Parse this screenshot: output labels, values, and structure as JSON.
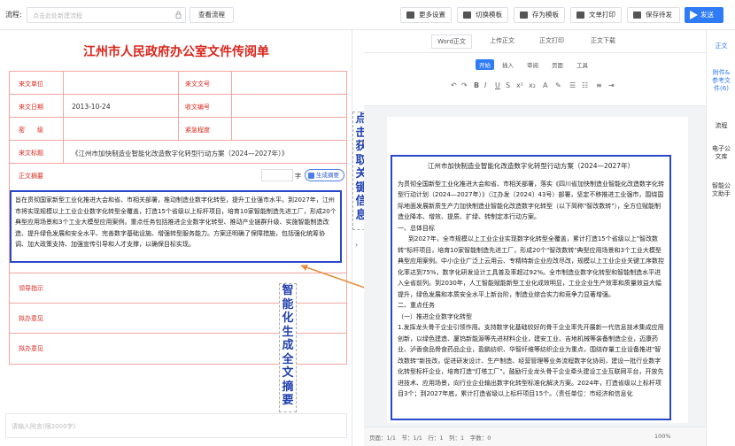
{
  "toolbar": {
    "flow_label": "流程:",
    "flow_placeholder": "点击此处新建流程",
    "view_flow": "查看流程",
    "more_settings": "更多设置",
    "switch_template": "切换模板",
    "save_template": "存为模板",
    "print": "文单打印",
    "save_send": "保存待发",
    "send": "发送"
  },
  "form": {
    "title": "江州市人民政府办公室文件传阅单",
    "unit_label": "来文单位",
    "docno_label": "来文文号",
    "date_label": "来文日期",
    "date_value": "2013-10-24",
    "recv_label": "收文编号",
    "secret_label": "密　　级",
    "urgent_label": "紧急程度",
    "subject_label": "来文标题",
    "subject_value": "《江州市加快制造业智能化改造数字化转型行动方案（2024—2027年）》",
    "summary_label": "正文摘要",
    "word_unit": "字",
    "gen_summary": "生成摘要",
    "summary_text": "旨在贯彻国家新型工业化推进大会和省、市相关部署，推动制造业数字化转型，提升工业强市水平。到2027年，江州市将实现规模以上工业企业数字化转型全覆盖，打造15个省级以上标杆项目，培育10家智能制造先进工厂，形成20个典型应用场景和3个工业大模型应用案例。重点任务包括推进企业数字化转型、推动产业链群升级、实施智能制造改造、提升绿色发展和安全水平、完善数字基础设施、增强转型服务能力。方案还明确了保障措施，包括强化统筹协调、加大政策支持、加强宣传引导和人才支撑，以确保目标实现。",
    "leader_label": "领导指示",
    "opinion1_label": "拟办意见",
    "opinion2_label": "拟办意见",
    "comment_placeholder": "请输入附言(限2000字)"
  },
  "annotations": {
    "click_key": "点击获取关键信息",
    "smart_summary": "智能化生成全文摘要"
  },
  "doc": {
    "word_format": "Word正文",
    "upload": "上传正文",
    "print": "正文打印",
    "download": "正文下载",
    "tabs": [
      "开始",
      "插入",
      "审阅",
      "页面",
      "工具"
    ],
    "title": "江州市加快制造业智能化改造数字化转型行动方案（2024—2027年）",
    "paragraphs": [
      "为贯彻全国新型工业化推进大会和省、市相关部署，落实《四川省加快制造业智能化改造数字化转型行动计划（2024—2027年）》（江办发〔2024〕43号）部署，坚定不移推进工业强市，围绕国际地面发展新质生产力加快制造业智能化改造数字化转型（以下简称\"智改数转\"），全方位赋能制造业降本、增效、提质、扩绿、转制定本行动方案。",
      "一、总体目标",
      "到2027年，全市规模以上工业企业实现数字化转型全覆盖，累计打造15个省级以上\"智改数转\"标杆项目，培育10家智能制造先进工厂，形成20个\"智改数转\"典型应用场景和3个工业大模型典型应用案例。中小企业广泛上云用云、专精特新企业应改尽改，规模以上工业企业关键工序数控化率达到75%，数字化研发设计工具普及率超过92%。全市制造业数字化转型和智能制造水平进入全省前列。到2030年，人工智能赋能新型工业化成效明显，工业企业生产效率和质量效益大幅提升，绿色发展和本质安全水平上新台阶，制造业综合实力和竞争力显著增强。",
      "二、重点任务",
      "（一）推进企业数字化转型",
      "1.发挥龙头骨干企业引领作用。支持数字化基础较好的骨干企业率先开展新一代信息技术集成应用创新，以绿色建造、厦钨新能源等先进材料企业，建安工业、吉地机械等装备制造企业，迈康药业、泸香食品骨食药品企业，盈鹏纺织、华智纤维等纺织企业为重点，围绕存量工业设备推进\"智改数转\"新技改，促进研发设计、生产制造、经营管理等业务流程数字化协同，建设一批行业数字化转型标杆企业，培育打造\"灯塔工厂\"。鼓励行业龙头骨干企业牵头建设工业互联网平台，开放先进技术、应用场景，向行业企业输出数字化转型标准化解决方案。2024年，打造省级以上标杆项目3个；到2027年底，累计打造省级以上标杆项目15个。（责任单位：市经济和信息化"
    ],
    "status": "页面：1/1　节：1/1　行：1　列：1　字数：0",
    "zoom": "100%"
  },
  "sidebar": [
    "正文",
    "附件&参考文件(6)",
    "流程",
    "电子公文库",
    "智能公文助手"
  ]
}
